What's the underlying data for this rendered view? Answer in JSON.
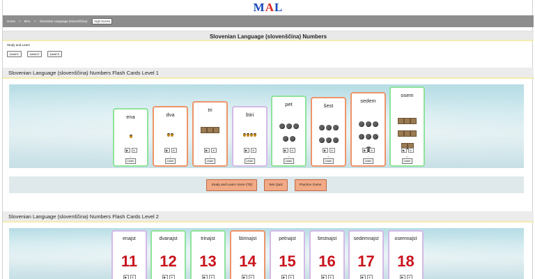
{
  "logo": {
    "letters": [
      "M",
      "A",
      "L"
    ],
    "colors": [
      "#1a47b8",
      "#d7261c",
      "#1a47b8"
    ]
  },
  "nav": {
    "items": [
      "Home",
      "MAL",
      "Slovenian Language (slovenščina)"
    ],
    "separators": [
      ">",
      ">"
    ],
    "highscores": "High Scores"
  },
  "page_title": "Slovenian Language (slovenščina) Numbers",
  "study_text": "Study and Learn",
  "level_buttons": [
    "Level 1",
    "Level 2",
    "Level 3"
  ],
  "section1": {
    "title": "Slovenian Language (slovenščina) Numbers Flash Cards Level 1",
    "cards": [
      {
        "word": "ena",
        "count": 1,
        "pic": "sun",
        "color": "green",
        "num": "1",
        "learn": "Learn"
      },
      {
        "word": "dva",
        "count": 2,
        "pic": "sun",
        "color": "orange",
        "num": "2",
        "learn": "Learn"
      },
      {
        "word": "tri",
        "count": 3,
        "pic": "box",
        "color": "orange",
        "num": "3",
        "learn": "Learn"
      },
      {
        "word": "štiri",
        "count": 4,
        "pic": "sun",
        "color": "lav",
        "num": "4",
        "learn": "Learn"
      },
      {
        "word": "pet",
        "count": 5,
        "pic": "dot",
        "color": "green",
        "num": "5",
        "learn": "Learn"
      },
      {
        "word": "šest",
        "count": 6,
        "pic": "dot",
        "color": "orange",
        "num": "6",
        "learn": "Learn"
      },
      {
        "word": "sedem",
        "count": 7,
        "pic": "dot",
        "color": "orange",
        "num": "7",
        "learn": "Learn"
      },
      {
        "word": "osem",
        "count": 8,
        "pic": "box",
        "color": "green",
        "num": "8",
        "learn": "Learn"
      }
    ]
  },
  "actions": [
    "Study and Learn Voice (TE)",
    "Win Quiz",
    "Practice Game"
  ],
  "section2": {
    "title": "Slovenian Language (slovenščina) Numbers Flash Cards Level 2",
    "cards": [
      {
        "word": "enajst",
        "number": "11",
        "color": "lav"
      },
      {
        "word": "dvanajst",
        "number": "12",
        "color": "green"
      },
      {
        "word": "trinajst",
        "number": "13",
        "color": "green"
      },
      {
        "word": "štirinajst",
        "number": "14",
        "color": "orange"
      },
      {
        "word": "petnajst",
        "number": "15",
        "color": "lav"
      },
      {
        "word": "šestnajst",
        "number": "16",
        "color": "lav"
      },
      {
        "word": "sedemnajst",
        "number": "17",
        "color": "lav"
      },
      {
        "word": "osemnajst",
        "number": "18",
        "color": "lav"
      }
    ]
  },
  "controls": {
    "play": "▶",
    "pause": "⏸"
  }
}
